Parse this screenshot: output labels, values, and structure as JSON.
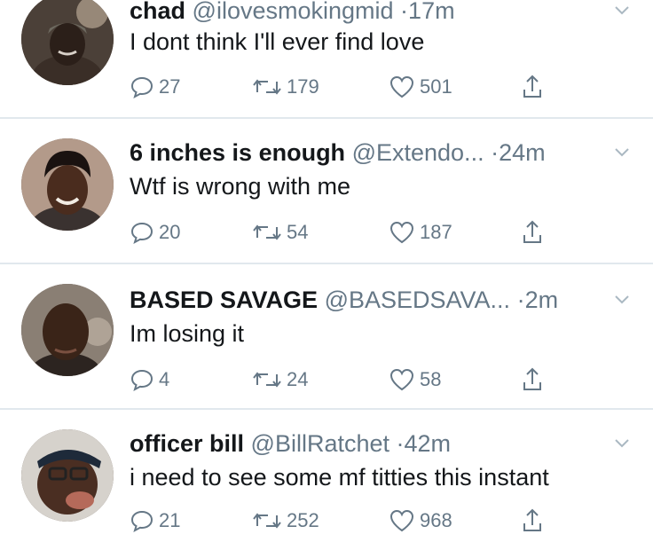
{
  "colors": {
    "text": "#14171a",
    "secondary": "#657786",
    "divider": "#e1e8ed",
    "background": "#ffffff"
  },
  "icons": {
    "reply": "speech-bubble-icon",
    "retweet": "retweet-arrows-icon",
    "like": "heart-icon",
    "share": "share-upload-icon",
    "menu": "chevron-down-icon"
  },
  "tweets": [
    {
      "name": "chad",
      "handle": "@ilovesmokingmid",
      "separator": "·",
      "time": "17m",
      "text": "I dont think I'll ever find love",
      "replies": "27",
      "retweets": "179",
      "likes": "501"
    },
    {
      "name": "6 inches is enough",
      "handle": "@Extendo...",
      "separator": "·",
      "time": "24m",
      "text": "Wtf is wrong with me",
      "replies": "20",
      "retweets": "54",
      "likes": "187"
    },
    {
      "name": "BASED SAVAGE",
      "handle": "@BASEDSAVA...",
      "separator": "·",
      "time": "2m",
      "text": "Im losing it",
      "replies": "4",
      "retweets": "24",
      "likes": "58"
    },
    {
      "name": "officer bill",
      "handle": "@BillRatchet",
      "separator": "·",
      "time": "42m",
      "text": "i need to see some mf titties this instant",
      "replies": "21",
      "retweets": "252",
      "likes": "968"
    }
  ]
}
